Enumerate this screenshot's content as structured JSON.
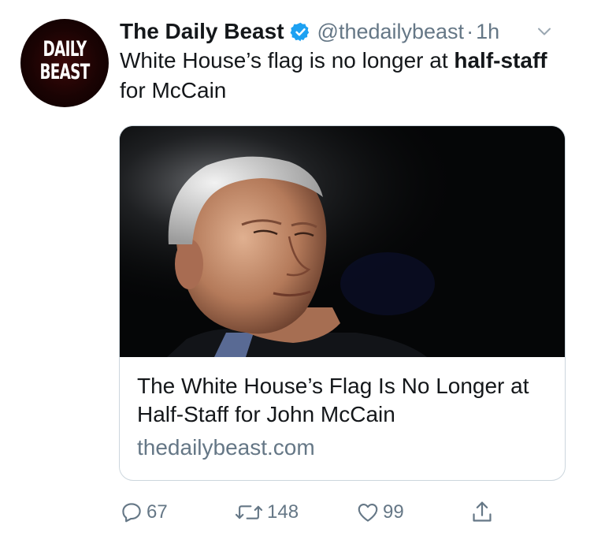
{
  "account": {
    "avatar_line1": "DAILY",
    "avatar_line2": "BEAST",
    "name": "The Daily Beast",
    "handle": "@thedailybeast",
    "separator": "·",
    "time": "1h"
  },
  "tweet": {
    "text_part1": "White House’s flag is no longer at ",
    "text_bold1": "half-staff",
    "text_part2": " for McCain"
  },
  "card": {
    "image_alt": "John McCain portrait",
    "title": "The White House’s Flag Is No Longer at Half-Staff for John McCain",
    "domain": "thedailybeast.com"
  },
  "actions": {
    "replies": "67",
    "retweets": "148",
    "likes": "99"
  },
  "colors": {
    "text": "#14171a",
    "muted": "#657786",
    "verified": "#1da1f2",
    "border": "#ccd6dd"
  },
  "icons": [
    "verified-badge-icon",
    "chevron-down-icon",
    "reply-icon",
    "retweet-icon",
    "like-icon",
    "share-icon"
  ]
}
